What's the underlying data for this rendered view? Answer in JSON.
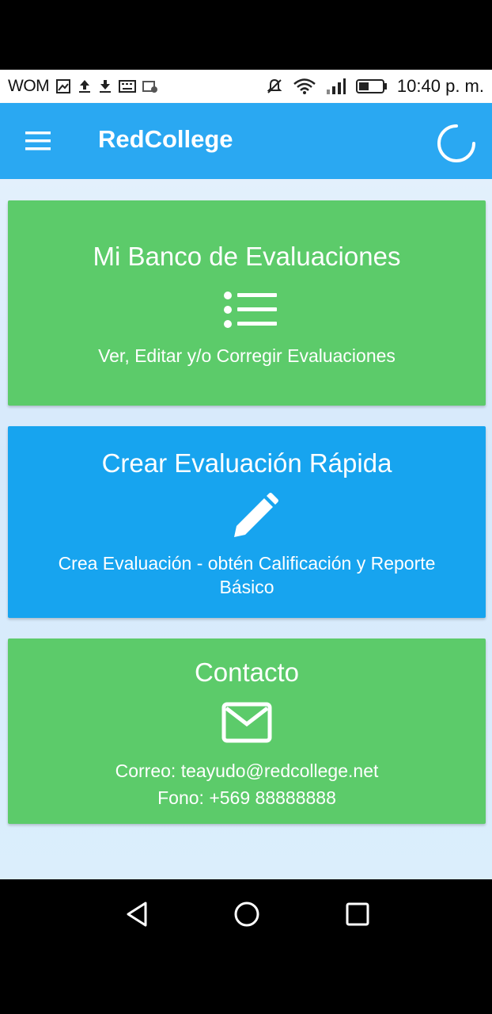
{
  "status_bar": {
    "carrier": "WOM",
    "time": "10:40 p. m.",
    "left_icons": [
      "gallery-icon",
      "upload-icon",
      "download-icon",
      "keyboard-icon",
      "sim-icon"
    ],
    "right_icons": [
      "mute-icon",
      "wifi-icon",
      "signal-icon",
      "battery-icon"
    ]
  },
  "app_bar": {
    "title": "RedCollege",
    "color": "#2aa8f2",
    "menu_icon": "hamburger-menu-icon",
    "loading_icon": "loading-spinner-icon"
  },
  "cards": [
    {
      "title": "Mi Banco de Evaluaciones",
      "icon": "list-icon",
      "subtitle": "Ver, Editar y/o Corregir Evaluaciones",
      "color": "#5ccb6a"
    },
    {
      "title": "Crear Evaluación Rápida",
      "icon": "pencil-icon",
      "subtitle": "Crea Evaluación - obtén Calificación y Reporte Básico",
      "color": "#17a4ef"
    },
    {
      "title": "Contacto",
      "icon": "mail-icon",
      "email": "Correo: teayudo@redcollege.net",
      "phone": "Fono: +569 88888888",
      "color": "#5ccb6a"
    }
  ],
  "nav_bar": {
    "buttons": [
      "back-triangle-icon",
      "home-circle-icon",
      "recents-square-icon"
    ]
  }
}
